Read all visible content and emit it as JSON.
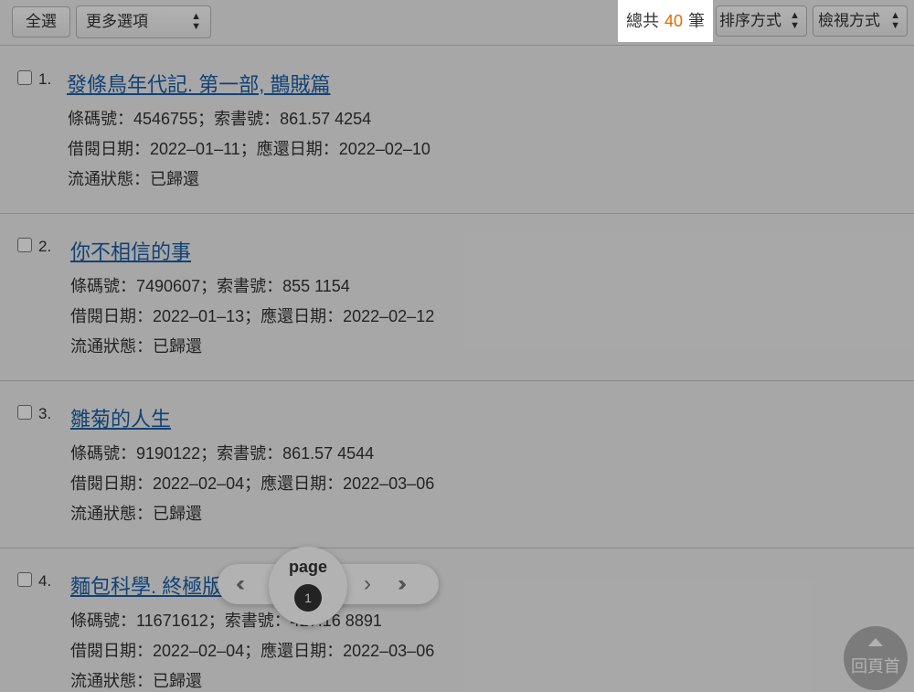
{
  "toolbar": {
    "select_all_label": "全選",
    "more_options_label": "更多選項",
    "total_prefix": "總共",
    "total_count": "40",
    "total_suffix": "筆",
    "sort_label": "排序方式",
    "view_label": "檢視方式"
  },
  "records": [
    {
      "number": "1.",
      "title": "發條鳥年代記. 第一部, 鵲賊篇",
      "barcode_line": "條碼號：4546755；索書號：861.57 4254",
      "dates_line": "借閱日期：2022–01–11；應還日期：2022–02–10",
      "status_line": "流通狀態：已歸還"
    },
    {
      "number": "2.",
      "title": "你不相信的事",
      "barcode_line": "條碼號：7490607；索書號：855 1154",
      "dates_line": "借閱日期：2022–01–13；應還日期：2022–02–12",
      "status_line": "流通狀態：已歸還"
    },
    {
      "number": "3.",
      "title": "雛菊的人生",
      "barcode_line": "條碼號：9190122；索書號：861.57 4544",
      "dates_line": "借閱日期：2022–02–04；應還日期：2022–03–06",
      "status_line": "流通狀態：已歸還"
    },
    {
      "number": "4.",
      "title": "麵包科學. 終極版",
      "barcode_line": "條碼號：11671612；索書號：427.16 8891",
      "dates_line": "借閱日期：2022–02–04；應還日期：2022–03–06",
      "status_line": "流通狀態：已歸還"
    }
  ],
  "pager": {
    "label": "page",
    "current_page": "1",
    "first_glyph": "‹‹",
    "next_glyph": "›",
    "last_glyph": "››"
  },
  "back_to_top": {
    "label": "回頁首"
  },
  "colors": {
    "link": "#1a5fa8",
    "count_accent": "#e06a00"
  }
}
